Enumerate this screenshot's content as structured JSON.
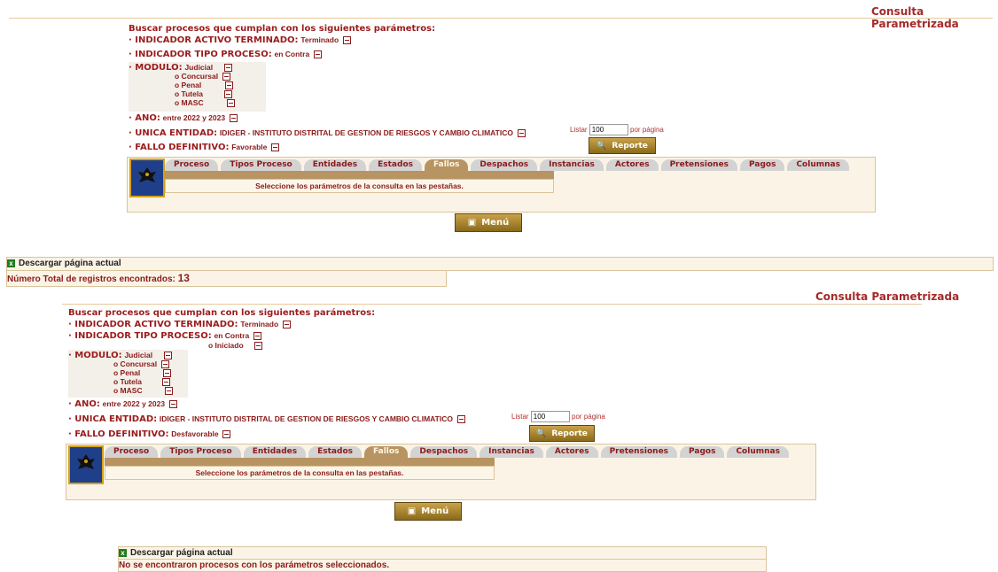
{
  "top": {
    "title": "Consulta Parametrizada",
    "heading": "Buscar procesos que cumplan con los siguientes parámetros:",
    "params": {
      "indicador_activo": {
        "label": "INDICADOR ACTIVO TERMINADO:",
        "value": "Terminado"
      },
      "indicador_tipo": {
        "label": "INDICADOR TIPO PROCESO:",
        "value": "en Contra"
      },
      "modulo": {
        "label": "MODULO:",
        "value": "Judicial",
        "extra": [
          "o Concursal",
          "o Penal",
          "o Tutela",
          "o MASC"
        ]
      },
      "ano": {
        "label": "ANO:",
        "value": "entre 2022 y 2023"
      },
      "entidad": {
        "label": "UNICA ENTIDAD:",
        "value": "IDIGER - INSTITUTO DISTRITAL DE GESTION DE RIESGOS Y CAMBIO CLIMATICO"
      },
      "fallo": {
        "label": "FALLO DEFINITIVO:",
        "value": "Favorable"
      }
    },
    "listar_label": "Listar",
    "listar_value": "100",
    "por_pagina": "por página",
    "reporte": "Reporte",
    "tabs": [
      "Proceso",
      "Tipos Proceso",
      "Entidades",
      "Estados",
      "Fallos",
      "Despachos",
      "Instancias",
      "Actores",
      "Pretensiones",
      "Pagos",
      "Columnas"
    ],
    "active_tab": "Fallos",
    "tab_message": "Seleccione los parámetros de la consulta en las pestañas.",
    "menu": "Menú",
    "download": "Descargar página actual",
    "total_label": "Número Total de registros encontrados:",
    "total_value": "13"
  },
  "bottom": {
    "title": "Consulta Parametrizada",
    "heading": "Buscar procesos que cumplan con los siguientes parámetros:",
    "params": {
      "indicador_activo": {
        "label": "INDICADOR ACTIVO TERMINADO:",
        "value": "Terminado"
      },
      "indicador_tipo": {
        "label": "INDICADOR TIPO PROCESO:",
        "value": "en Contra",
        "extra": [
          "o Iniciado"
        ]
      },
      "modulo": {
        "label": "MODULO:",
        "value": "Judicial",
        "extra": [
          "o Concursal",
          "o Penal",
          "o Tutela",
          "o MASC"
        ]
      },
      "ano": {
        "label": "ANO:",
        "value": "entre 2022 y 2023"
      },
      "entidad": {
        "label": "UNICA ENTIDAD:",
        "value": "IDIGER - INSTITUTO DISTRITAL DE GESTION DE RIESGOS Y CAMBIO CLIMATICO"
      },
      "fallo": {
        "label": "FALLO DEFINITIVO:",
        "value": "Desfavorable"
      }
    },
    "listar_label": "Listar",
    "listar_value": "100",
    "por_pagina": "por página",
    "reporte": "Reporte",
    "tabs": [
      "Proceso",
      "Tipos Proceso",
      "Entidades",
      "Estados",
      "Fallos",
      "Despachos",
      "Instancias",
      "Actores",
      "Pretensiones",
      "Pagos",
      "Columnas"
    ],
    "active_tab": "Fallos",
    "tab_message": "Seleccione los parámetros de la consulta en las pestañas.",
    "menu": "Menú",
    "download": "Descargar página actual",
    "no_results": "No se encontraron procesos con los parámetros seleccionados."
  },
  "colors": {
    "accent": "#a52a2a",
    "tab_active": "#b89463",
    "panel": "#fbf4e6",
    "button": "#9a7a2a"
  },
  "icons": {
    "crest": "bogota-crest-icon",
    "excel": "excel-icon",
    "binoculars": "binoculars-icon",
    "menu": "menu-icon",
    "collapse": "minus-box-icon"
  }
}
